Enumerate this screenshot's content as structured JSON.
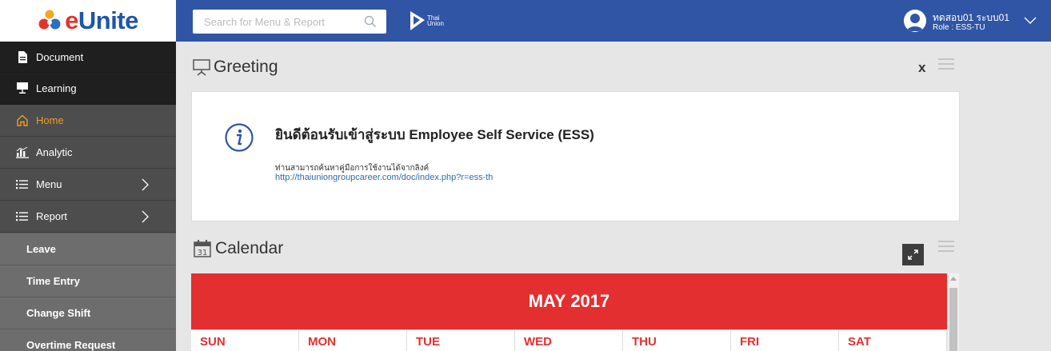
{
  "brand": {
    "logo_text_e": "e",
    "logo_text_rest": "Unite",
    "thai_union_line1": "Thai",
    "thai_union_line2": "Union"
  },
  "search": {
    "placeholder": "Search for Menu & Report"
  },
  "user": {
    "name": "ทดสอบ01 ระบบ01",
    "role": "Role : ESS-TU"
  },
  "sidebar": {
    "items": [
      {
        "label": "Document",
        "icon": "document-icon"
      },
      {
        "label": "Learning",
        "icon": "presentation-icon"
      },
      {
        "label": "Home",
        "icon": "home-icon"
      },
      {
        "label": "Analytic",
        "icon": "bar-chart-icon"
      },
      {
        "label": "Menu",
        "icon": "list-icon"
      },
      {
        "label": "Report",
        "icon": "list-icon"
      },
      {
        "label": "Leave"
      },
      {
        "label": "Time Entry"
      },
      {
        "label": "Change Shift"
      },
      {
        "label": "Overtime Request"
      }
    ]
  },
  "greeting": {
    "title": "Greeting",
    "close_label": "x",
    "heading": "ยินดีต้อนรับเข้าสู่ระบบ Employee Self Service (ESS)",
    "body": "ท่านสามารถค้นหาคู่มือการใช้งานได้จากลิงค์",
    "link": "http://thaiuniongroupcareer.com/doc/index.php?r=ess-th"
  },
  "calendar": {
    "title": "Calendar",
    "icon_day": "31",
    "month": "MAY 2017",
    "days": [
      "SUN",
      "MON",
      "TUE",
      "WED",
      "THU",
      "FRI",
      "SAT"
    ]
  },
  "colors": {
    "topbar": "#2f55a4",
    "calendar_header": "#e32f2f",
    "home_active": "#f39c20",
    "link": "#2e6ab3"
  }
}
